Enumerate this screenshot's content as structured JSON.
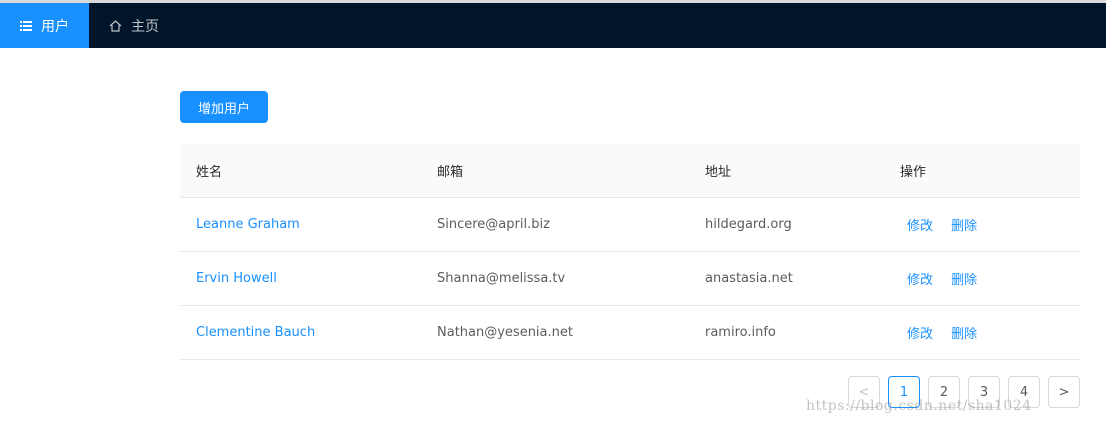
{
  "nav": {
    "items": [
      {
        "label": "用户",
        "icon": "list-icon",
        "active": true
      },
      {
        "label": "主页",
        "icon": "home-icon",
        "active": false
      }
    ]
  },
  "toolbar": {
    "add_label": "增加用户"
  },
  "table": {
    "columns": [
      "姓名",
      "邮箱",
      "地址",
      "操作"
    ],
    "rows": [
      {
        "name": "Leanne Graham",
        "email": "Sincere@april.biz",
        "address": "hildegard.org",
        "edit": "修改",
        "delete": "删除"
      },
      {
        "name": "Ervin Howell",
        "email": "Shanna@melissa.tv",
        "address": "anastasia.net",
        "edit": "修改",
        "delete": "删除"
      },
      {
        "name": "Clementine Bauch",
        "email": "Nathan@yesenia.net",
        "address": "ramiro.info",
        "edit": "修改",
        "delete": "删除"
      }
    ]
  },
  "pagination": {
    "prev": "<",
    "pages": [
      "1",
      "2",
      "3",
      "4"
    ],
    "current": "1",
    "next": ">"
  },
  "watermark": "https://blog.csdn.net/sha1024",
  "colors": {
    "nav_bg": "#001529",
    "accent": "#1890ff"
  }
}
